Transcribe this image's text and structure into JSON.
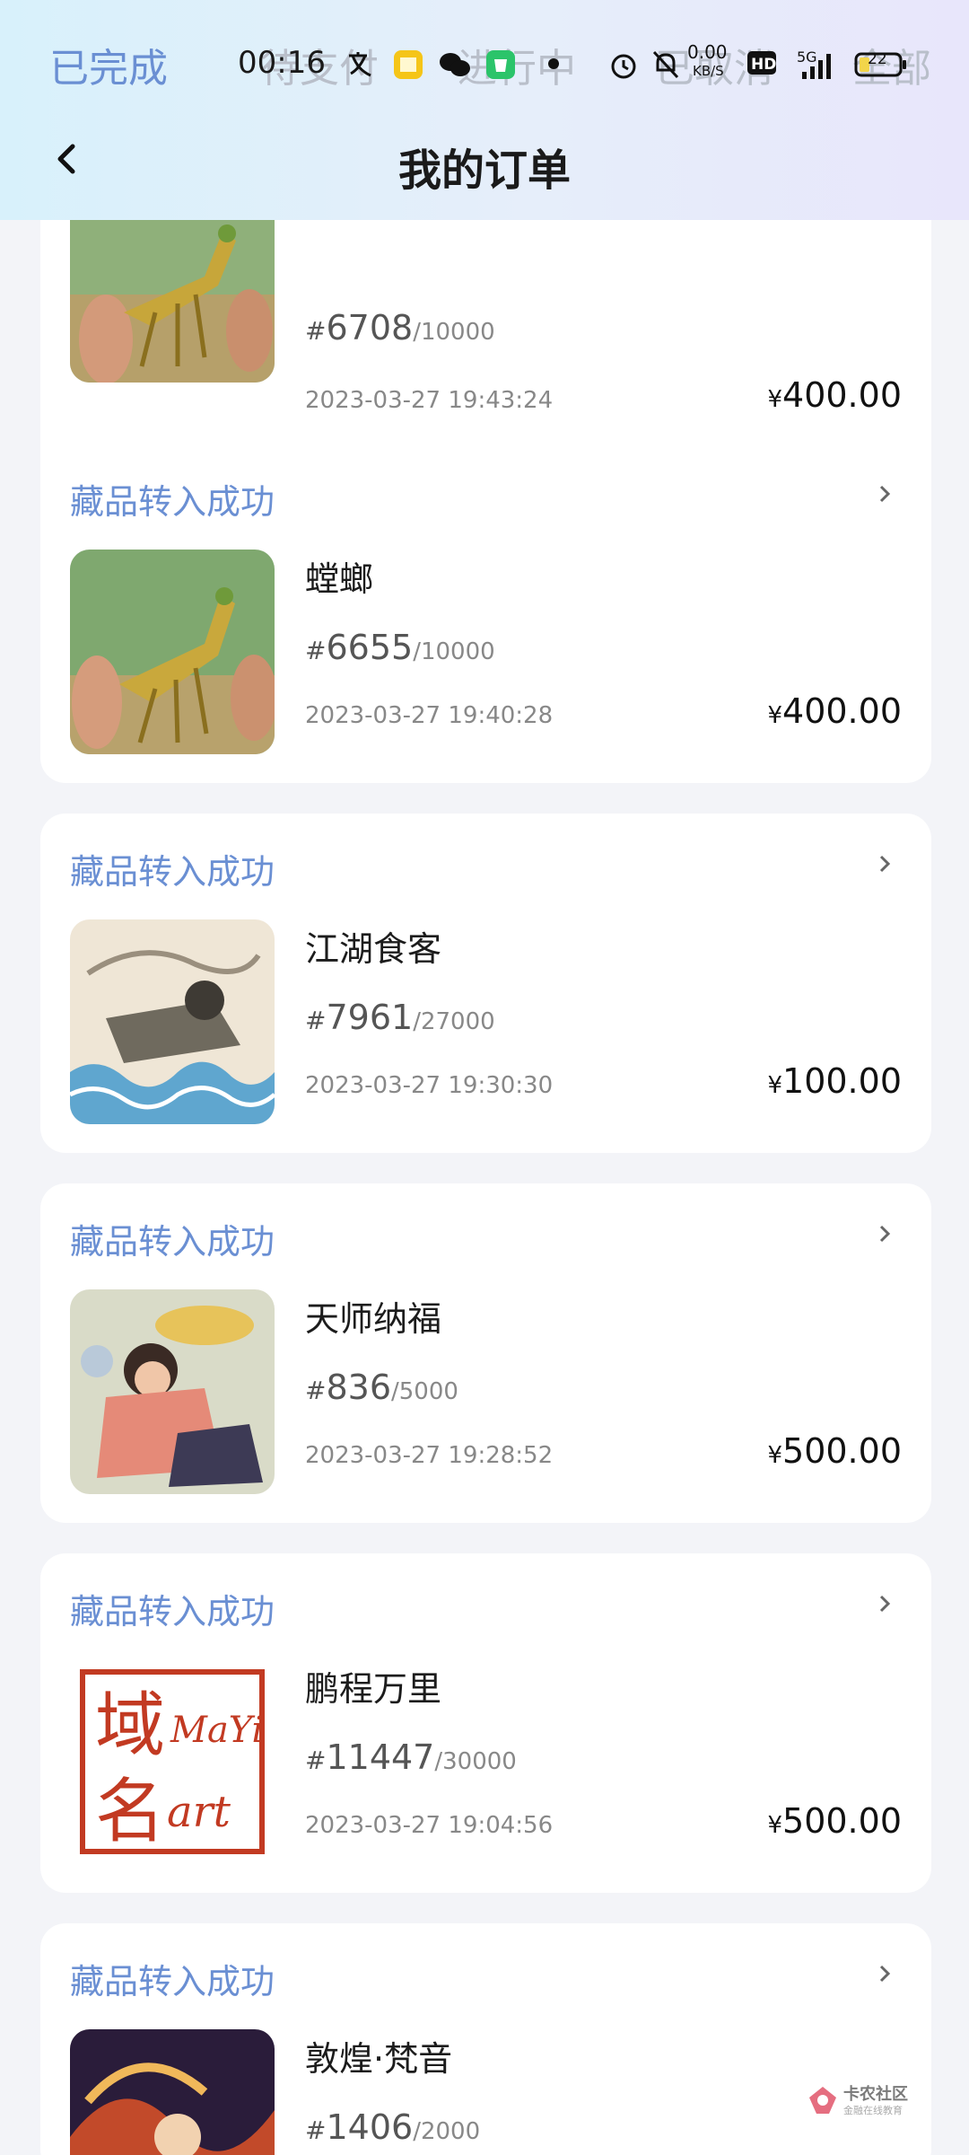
{
  "tabs": [
    "已完成",
    "待支付",
    "进行中",
    "已取消",
    "全部"
  ],
  "status_bar": {
    "time": "00:16",
    "net_speed": "0.00",
    "net_unit": "KB/S",
    "signal": "5G",
    "battery": "22"
  },
  "page_title": "我的订单",
  "orders": [
    {
      "status": "",
      "name": "",
      "serial_no": "6708",
      "serial_total": "/10000",
      "date": "2023-03-27 19:43:24",
      "currency": "¥",
      "price": "400.00",
      "thumb": "mantis"
    },
    {
      "status": "藏品转入成功",
      "name": "螳螂",
      "serial_no": "6655",
      "serial_total": "/10000",
      "date": "2023-03-27 19:40:28",
      "currency": "¥",
      "price": "400.00",
      "thumb": "mantis"
    },
    {
      "status": "藏品转入成功",
      "name": "江湖食客",
      "serial_no": "7961",
      "serial_total": "/27000",
      "date": "2023-03-27 19:30:30",
      "currency": "¥",
      "price": "100.00",
      "thumb": "waves-painting"
    },
    {
      "status": "藏品转入成功",
      "name": "天师纳福",
      "serial_no": "836",
      "serial_total": "/5000",
      "date": "2023-03-27 19:28:52",
      "currency": "¥",
      "price": "500.00",
      "thumb": "celestial-master"
    },
    {
      "status": "藏品转入成功",
      "name": "鹏程万里",
      "serial_no": "11447",
      "serial_total": "/30000",
      "date": "2023-03-27 19:04:56",
      "currency": "¥",
      "price": "500.00",
      "thumb": "mayi-art-seal"
    },
    {
      "status": "藏品转入成功",
      "name": "敦煌·梵音",
      "serial_no": "1406",
      "serial_total": "/2000",
      "date": "",
      "currency": "",
      "price": "",
      "thumb": "dunhuang"
    }
  ],
  "hash_symbol": "#",
  "seal_text": {
    "line1": "域",
    "line2": "MaYi",
    "line3": "名",
    "line4": "art"
  },
  "watermark": {
    "title": "卡农社区",
    "subtitle": "金融在线教育"
  },
  "colors": {
    "accent": "#6a8fd3",
    "background": "#f3f4f8",
    "card": "#ffffff"
  }
}
